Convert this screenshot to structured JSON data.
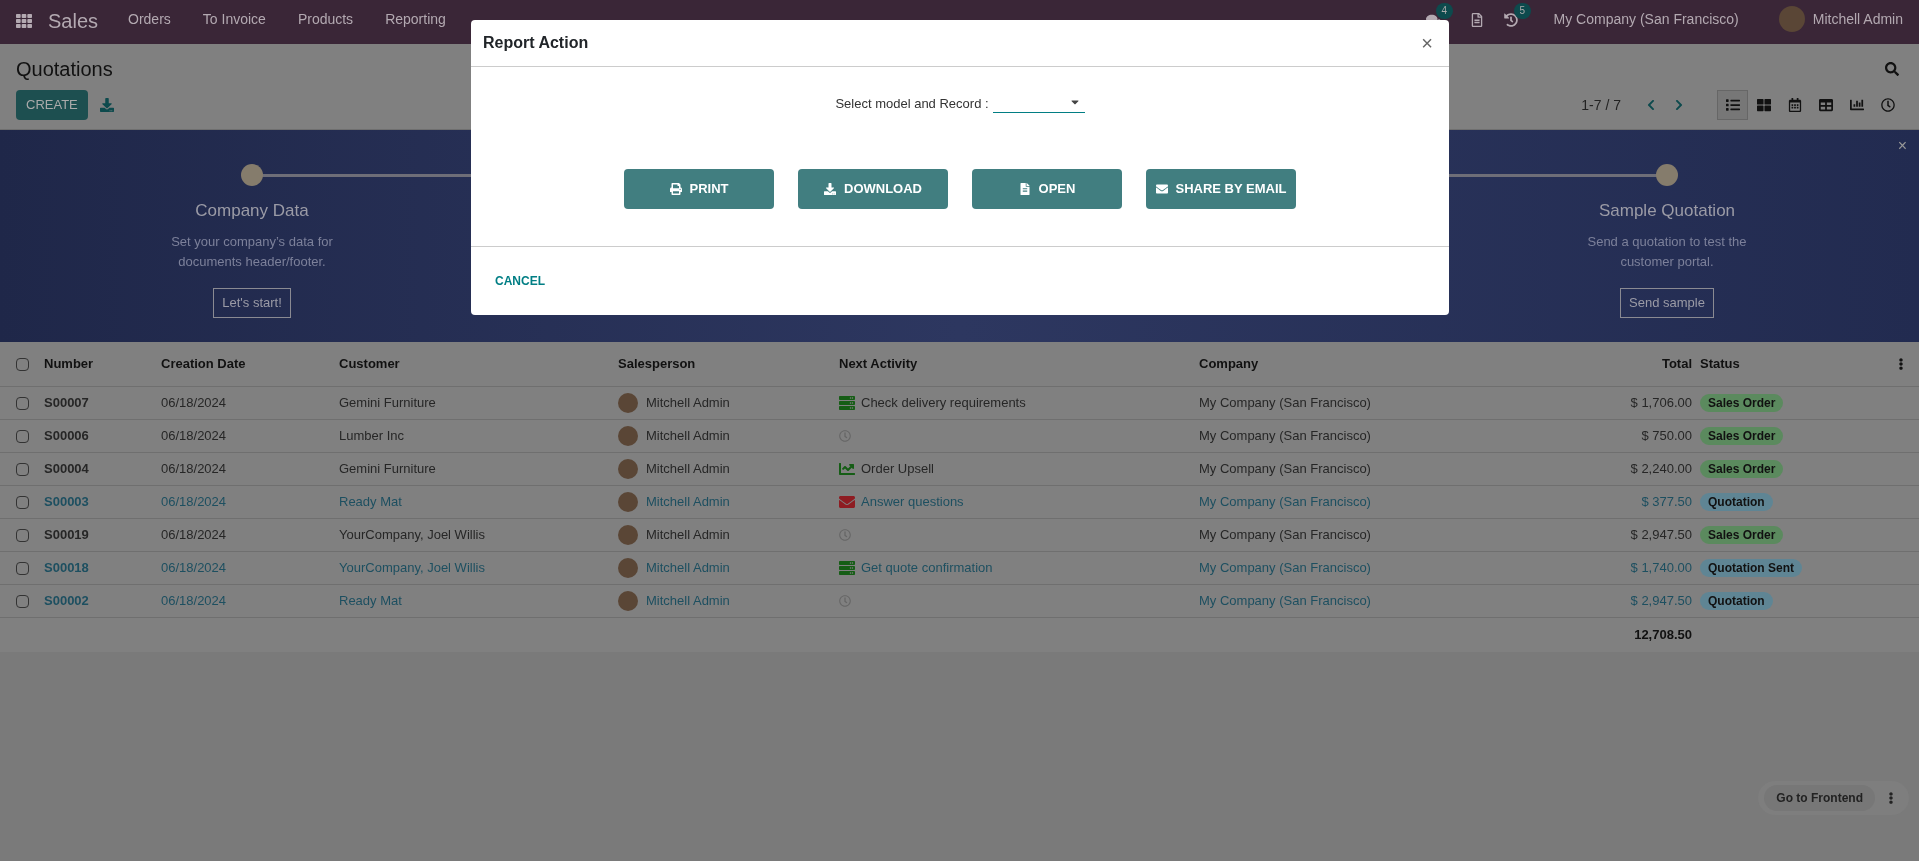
{
  "navbar": {
    "app": "Sales",
    "menu": [
      "Orders",
      "To Invoice",
      "Products",
      "Reporting"
    ],
    "chat_count": "4",
    "activity_count": "5",
    "company": "My Company (San Francisco)",
    "user": "Mitchell Admin"
  },
  "control_panel": {
    "title": "Quotations",
    "create": "CREATE",
    "pager": "1-7 / 7",
    "views": [
      {
        "kind": "list",
        "selected": true
      },
      {
        "kind": "kanban",
        "selected": false
      },
      {
        "kind": "calendar",
        "selected": false
      },
      {
        "kind": "pivot",
        "selected": false
      },
      {
        "kind": "graph",
        "selected": false
      },
      {
        "kind": "activity",
        "selected": false
      }
    ]
  },
  "onboarding": {
    "close": "×",
    "steps": [
      {
        "title": "Company Data",
        "description": "Set your company’s data for documents header/footer.",
        "button": "Let's start!"
      },
      {
        "title": "Sample Quotation",
        "description": "Send a quotation to test the customer portal.",
        "button": "Send sample"
      }
    ]
  },
  "table": {
    "all_checked": false,
    "columns": [
      "Number",
      "Creation Date",
      "Customer",
      "Salesperson",
      "Next Activity",
      "Company",
      "Total",
      "Status"
    ],
    "rows": [
      {
        "checked": false,
        "highlighted": false,
        "number": "S00007",
        "date": "06/18/2024",
        "customer": "Gemini Furniture",
        "salesperson": "Mitchell Admin",
        "activity": {
          "kind": "todo",
          "label": "Check delivery requirements"
        },
        "company": "My Company (San Francisco)",
        "total": "$ 1,706.00",
        "status": "Sales Order",
        "color": "#5b8a5e"
      },
      {
        "checked": false,
        "highlighted": false,
        "number": "S00006",
        "date": "06/18/2024",
        "customer": "Lumber Inc",
        "salesperson": "Mitchell Admin",
        "activity": {
          "kind": "none"
        },
        "company": "My Company (San Francisco)",
        "total": "$ 750.00",
        "status": "Sales Order",
        "color": "#5b8a5e"
      },
      {
        "checked": false,
        "highlighted": false,
        "number": "S00004",
        "date": "06/18/2024",
        "customer": "Gemini Furniture",
        "salesperson": "Mitchell Admin",
        "activity": {
          "kind": "upsell",
          "label": "Order Upsell"
        },
        "company": "My Company (San Francisco)",
        "total": "$ 2,240.00",
        "status": "Sales Order",
        "color": "#5b8a5e"
      },
      {
        "checked": false,
        "highlighted": true,
        "number": "S00003",
        "date": "06/18/2024",
        "customer": "Ready Mat",
        "salesperson": "Mitchell Admin",
        "activity": {
          "kind": "email",
          "label": "Answer questions"
        },
        "company": "My Company (San Francisco)",
        "total": "$ 377.50",
        "status": "Quotation",
        "color": "#5f8594"
      },
      {
        "checked": false,
        "highlighted": false,
        "number": "S00019",
        "date": "06/18/2024",
        "customer": "YourCompany, Joel Willis",
        "salesperson": "Mitchell Admin",
        "activity": {
          "kind": "none"
        },
        "company": "My Company (San Francisco)",
        "total": "$ 2,947.50",
        "status": "Sales Order",
        "color": "#5b8a5e"
      },
      {
        "checked": false,
        "highlighted": true,
        "number": "S00018",
        "date": "06/18/2024",
        "customer": "YourCompany, Joel Willis",
        "salesperson": "Mitchell Admin",
        "activity": {
          "kind": "todo",
          "label": "Get quote confirmation"
        },
        "company": "My Company (San Francisco)",
        "total": "$ 1,740.00",
        "status": "Quotation Sent",
        "color": "#5f8594"
      },
      {
        "checked": false,
        "highlighted": true,
        "number": "S00002",
        "date": "06/18/2024",
        "customer": "Ready Mat",
        "salesperson": "Mitchell Admin",
        "activity": {
          "kind": "none"
        },
        "company": "My Company (San Francisco)",
        "total": "$ 2,947.50",
        "status": "Quotation",
        "color": "#5f8594"
      }
    ],
    "sum": "12,708.50"
  },
  "dialog": {
    "title": "Report Action",
    "close": "×",
    "field_label": "Select model and Record :",
    "buttons": [
      {
        "kind": "print",
        "label": "PRINT"
      },
      {
        "kind": "download",
        "label": "DOWNLOAD"
      },
      {
        "kind": "open",
        "label": "OPEN"
      },
      {
        "kind": "email",
        "label": "SHARE BY EMAIL"
      }
    ],
    "cancel": "CANCEL"
  },
  "frontend": {
    "label": "Go to Frontend"
  }
}
